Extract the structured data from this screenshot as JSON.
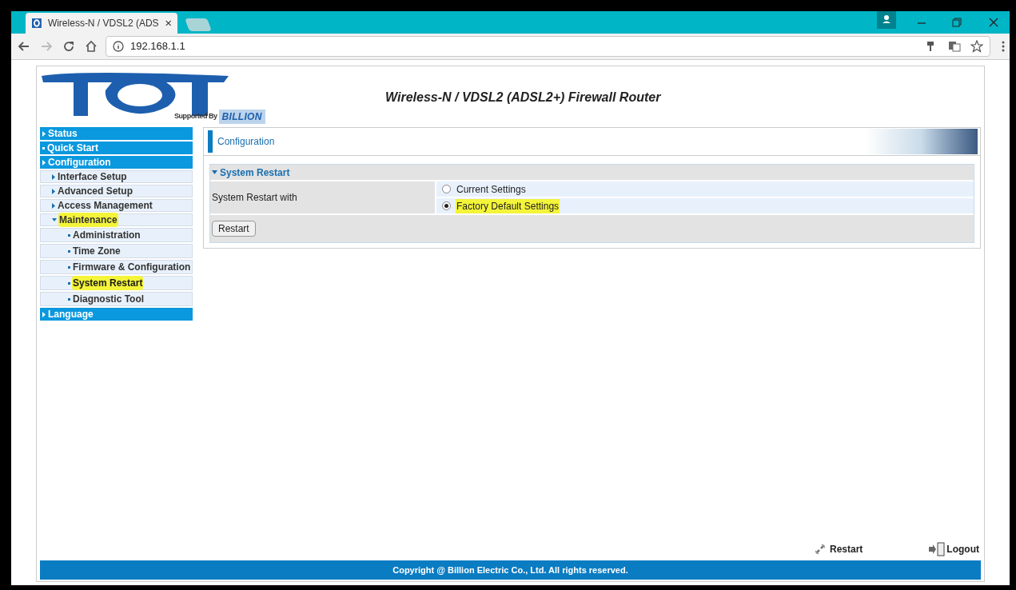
{
  "browser": {
    "tab_title": "Wireless-N / VDSL2 (ADS",
    "url": "192.168.1.1"
  },
  "header": {
    "logo_caption": "Supported By",
    "logo_brand": "BILLION",
    "title": "Wireless-N / VDSL2 (ADSL2+) Firewall Router"
  },
  "sidebar": {
    "items": [
      {
        "label": "Status",
        "kind": "top",
        "expandable": true,
        "expanded": false,
        "highlighted": false,
        "selected": false
      },
      {
        "label": "Quick Start",
        "kind": "top",
        "expandable": false,
        "highlighted": false,
        "selected": false
      },
      {
        "label": "Configuration",
        "kind": "top",
        "expandable": true,
        "expanded": false,
        "highlighted": false,
        "selected": false
      },
      {
        "label": "Interface Setup",
        "kind": "sub",
        "expandable": true,
        "expanded": false,
        "highlighted": false,
        "selected": false
      },
      {
        "label": "Advanced Setup",
        "kind": "sub",
        "expandable": true,
        "expanded": false,
        "highlighted": false,
        "selected": false
      },
      {
        "label": "Access Management",
        "kind": "sub",
        "expandable": true,
        "expanded": false,
        "highlighted": false,
        "selected": false
      },
      {
        "label": "Maintenance",
        "kind": "sub",
        "expandable": true,
        "expanded": true,
        "highlighted": true,
        "selected": false
      },
      {
        "label": "Administration",
        "kind": "leaf",
        "expandable": false,
        "highlighted": false,
        "selected": false
      },
      {
        "label": "Time Zone",
        "kind": "leaf",
        "expandable": false,
        "highlighted": false,
        "selected": false
      },
      {
        "label": "Firmware & Configuration",
        "kind": "leaf",
        "expandable": false,
        "highlighted": false,
        "selected": false
      },
      {
        "label": "System Restart",
        "kind": "leaf",
        "expandable": false,
        "highlighted": true,
        "selected": true
      },
      {
        "label": "Diagnostic Tool",
        "kind": "leaf",
        "expandable": false,
        "highlighted": false,
        "selected": false
      },
      {
        "label": "Language",
        "kind": "top",
        "expandable": true,
        "expanded": false,
        "highlighted": false,
        "selected": false
      }
    ]
  },
  "content": {
    "heading": "Configuration",
    "section": "System Restart",
    "field_label": "System Restart with",
    "options": [
      {
        "label": "Current Settings",
        "selected": false,
        "highlighted": false
      },
      {
        "label": "Factory Default Settings",
        "selected": true,
        "highlighted": true
      }
    ],
    "button": "Restart"
  },
  "footer": {
    "restart_link": "Restart",
    "logout_link": "Logout",
    "copyright": "Copyright @ Billion Electric Co., Ltd. All rights reserved."
  }
}
